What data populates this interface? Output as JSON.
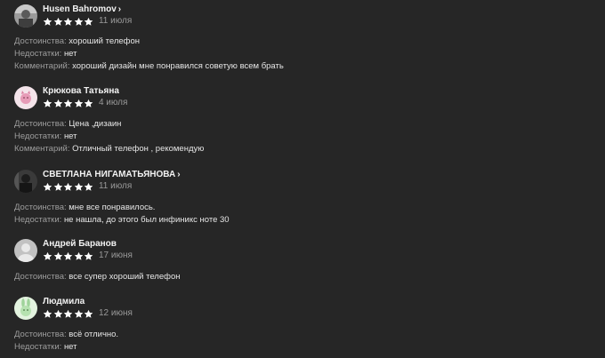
{
  "reviews": [
    {
      "author": "Husen Bahromov",
      "has_chevron": true,
      "rating": 5,
      "date": "11 июля",
      "avatar": "photo-avatar-gray",
      "lines": [
        {
          "label": "Достоинства:",
          "value": "хороший телефон"
        },
        {
          "label": "Недостатки:",
          "value": "нет"
        },
        {
          "label": "Комментарий:",
          "value": "хороший дизайн мне понравился советую всем брать"
        }
      ]
    },
    {
      "author": "Крюкова Татьяна",
      "has_chevron": false,
      "rating": 5,
      "date": "4 июля",
      "avatar": "pink-cat-avatar",
      "lines": [
        {
          "label": "Достоинства:",
          "value": "Цена ,дизаин"
        },
        {
          "label": "Недостатки:",
          "value": "нет"
        },
        {
          "label": "Комментарий:",
          "value": "Отличный телефон , рекомендую"
        }
      ]
    },
    {
      "author": "СВЕТЛАНА НИГАМАТЬЯНОВА",
      "has_chevron": true,
      "rating": 5,
      "date": "11 июля",
      "avatar": "photo-avatar-dark",
      "lines": [
        {
          "label": "Достоинства:",
          "value": "мне все понравилось."
        },
        {
          "label": "Недостатки:",
          "value": "не нашла, до этого был инфиникс ноте 30"
        }
      ]
    },
    {
      "author": "Андрей Баранов",
      "has_chevron": false,
      "rating": 5,
      "date": "17 июня",
      "avatar": "default-person-avatar",
      "lines": [
        {
          "label": "Достоинства:",
          "value": "все супер хороший телефон"
        }
      ]
    },
    {
      "author": "Людмила",
      "has_chevron": false,
      "rating": 5,
      "date": "12 июня",
      "avatar": "green-bunny-avatar",
      "lines": [
        {
          "label": "Достоинства:",
          "value": "всё отлично."
        },
        {
          "label": "Недостатки:",
          "value": "нет"
        }
      ]
    }
  ],
  "colors": {
    "background": "#262626",
    "star": "#ffffff",
    "label": "#9d9d9d",
    "text": "#e6e6e6",
    "date": "#9a9a9a"
  }
}
